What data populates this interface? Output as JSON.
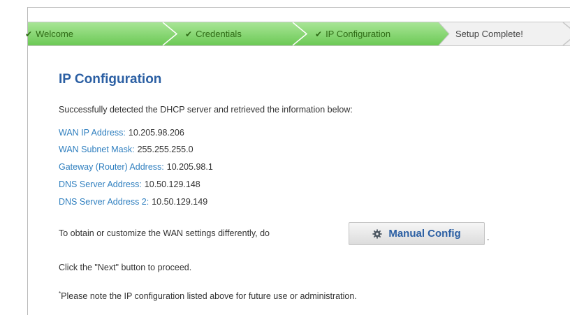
{
  "wizard": {
    "steps": [
      {
        "label": "Welcome",
        "status": "done",
        "check": "✔"
      },
      {
        "label": "Credentials",
        "status": "done",
        "check": "✔"
      },
      {
        "label": "IP Configuration",
        "status": "done",
        "check": "✔"
      },
      {
        "label": "Setup Complete!",
        "status": "current",
        "check": ""
      }
    ]
  },
  "main": {
    "title": "IP Configuration",
    "intro": "Successfully detected the DHCP server and retrieved the information below:",
    "fields": [
      {
        "label": "WAN IP Address:",
        "value": "10.205.98.206"
      },
      {
        "label": "WAN Subnet Mask:",
        "value": "255.255.255.0"
      },
      {
        "label": "Gateway (Router) Address:",
        "value": "10.205.98.1"
      },
      {
        "label": "DNS Server Address:",
        "value": "10.50.129.148"
      },
      {
        "label": "DNS Server Address 2:",
        "value": "10.50.129.149"
      }
    ],
    "customize_text": "To obtain or customize the WAN settings differently, do",
    "manual_config_label": "Manual Config",
    "manual_config_icon": "gear-icon",
    "trailing_period": ".",
    "next_text": "Click the \"Next\" button to proceed.",
    "note_marker": "*",
    "note_text": "Please note the IP configuration listed above for future use or administration."
  },
  "colors": {
    "done_step_bg": "#7fd36b",
    "title_blue": "#2b5fa3",
    "label_blue": "#2f7fbf"
  }
}
